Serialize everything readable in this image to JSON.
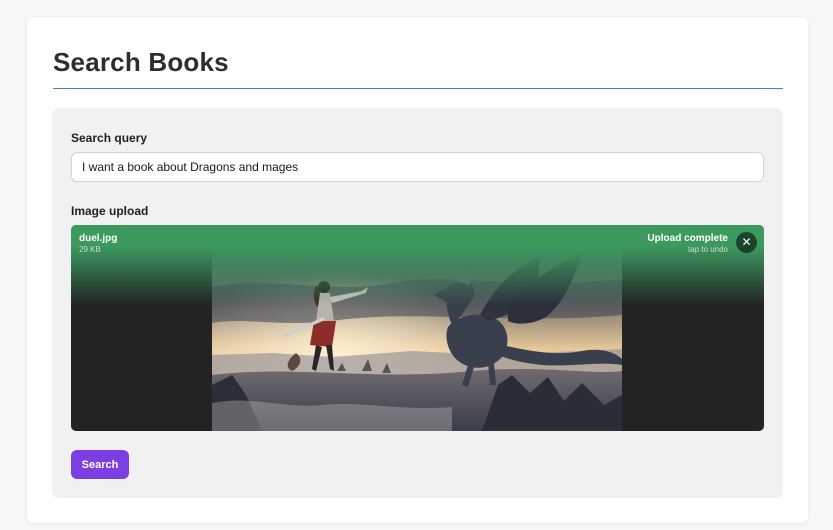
{
  "page": {
    "title": "Search Books"
  },
  "search": {
    "label": "Search query",
    "value": "I want a book about Dragons and mages"
  },
  "image_upload": {
    "label": "Image upload",
    "file_name": "duel.jpg",
    "file_size": "29 KB",
    "status": "Upload complete",
    "undo_hint": "tap to undo",
    "remove_icon": "close-icon",
    "status_color": "#3c9a5f"
  },
  "actions": {
    "search_label": "Search"
  },
  "colors": {
    "accent": "#7b3fe4",
    "rule": "#4a7bd6",
    "panel": "#f1f1f1"
  }
}
